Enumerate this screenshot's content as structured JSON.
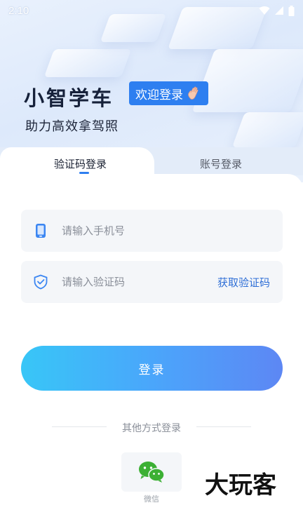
{
  "status_bar": {
    "time": "2:10"
  },
  "header": {
    "brand": "小智学车",
    "welcome": "欢迎登录",
    "slogan": "助力高效拿驾照"
  },
  "tabs": [
    {
      "label": "验证码登录",
      "active": true
    },
    {
      "label": "账号登录",
      "active": false
    }
  ],
  "form": {
    "phone_placeholder": "请输入手机号",
    "code_placeholder": "请输入验证码",
    "get_code_label": "获取验证码",
    "login_label": "登录"
  },
  "other_login": {
    "label": "其他方式登录",
    "wechat_label": "微信"
  },
  "watermark": "大玩客",
  "colors": {
    "accent": "#2f7ff0",
    "button_start": "#38c6f7",
    "button_end": "#5d87f4",
    "wechat_green": "#3cb034"
  },
  "icons": {
    "signal": "signal-icon",
    "wifi": "wifi-icon",
    "battery": "battery-icon",
    "wave_hand": "waving-hand-icon",
    "phone": "phone-icon",
    "shield": "shield-check-icon",
    "wechat": "wechat-icon"
  }
}
